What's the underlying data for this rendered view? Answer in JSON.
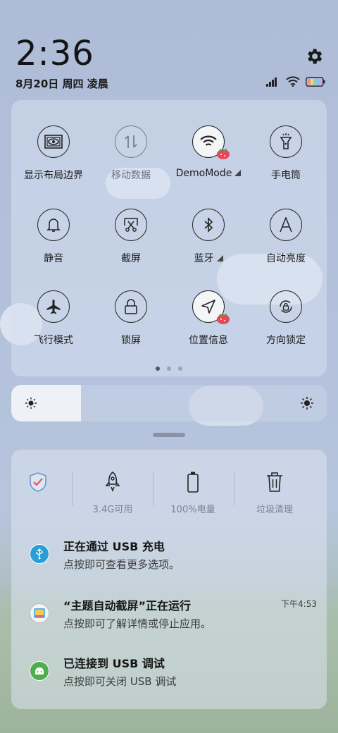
{
  "status": {
    "time": "2:36",
    "date": "8月20日 周四 凌晨"
  },
  "quick_settings": {
    "row1": [
      {
        "label": "显示布局边界",
        "icon": "layout-bounds-icon",
        "state": "off"
      },
      {
        "label": "移动数据",
        "icon": "mobile-data-icon",
        "state": "disabled"
      },
      {
        "label": "DemoMode",
        "icon": "wifi-icon",
        "state": "on",
        "expandable": true
      },
      {
        "label": "手电筒",
        "icon": "flashlight-icon",
        "state": "off"
      }
    ],
    "row2": [
      {
        "label": "静音",
        "icon": "bell-icon",
        "state": "off"
      },
      {
        "label": "截屏",
        "icon": "screenshot-icon",
        "state": "off"
      },
      {
        "label": "蓝牙",
        "icon": "bluetooth-icon",
        "state": "off",
        "expandable": true
      },
      {
        "label": "自动亮度",
        "icon": "auto-brightness-icon",
        "state": "off"
      }
    ],
    "row3": [
      {
        "label": "飞行模式",
        "icon": "airplane-icon",
        "state": "off"
      },
      {
        "label": "锁屏",
        "icon": "lock-icon",
        "state": "off"
      },
      {
        "label": "位置信息",
        "icon": "location-icon",
        "state": "on"
      },
      {
        "label": "方向锁定",
        "icon": "rotation-lock-icon",
        "state": "off"
      }
    ],
    "page_count": 3,
    "active_page": 1
  },
  "brightness": {
    "level": 0.22
  },
  "quick_actions": [
    {
      "label": "",
      "icon": "security-shield-icon"
    },
    {
      "label": "3.4G可用",
      "icon": "rocket-icon"
    },
    {
      "label": "100%电量",
      "icon": "battery-icon"
    },
    {
      "label": "垃圾清理",
      "icon": "trash-icon"
    }
  ],
  "notifications": [
    {
      "title": "正在通过 USB 充电",
      "text": "点按即可查看更多选项。",
      "time": "",
      "icon": "usb-icon",
      "color": "#2a9fd6"
    },
    {
      "title": "“主题自动截屏”正在运行",
      "text": "点按即可了解详情或停止应用。",
      "time": "下午4:53",
      "icon": "theme-app-icon",
      "color": "#f0a030"
    },
    {
      "title": "已连接到 USB 调试",
      "text": "点按即可关闭 USB 调试",
      "time": "",
      "icon": "android-icon",
      "color": "#4cae4c"
    }
  ],
  "colors": {
    "accent": "#2a9fd6",
    "badge_red": "#e8475a"
  }
}
